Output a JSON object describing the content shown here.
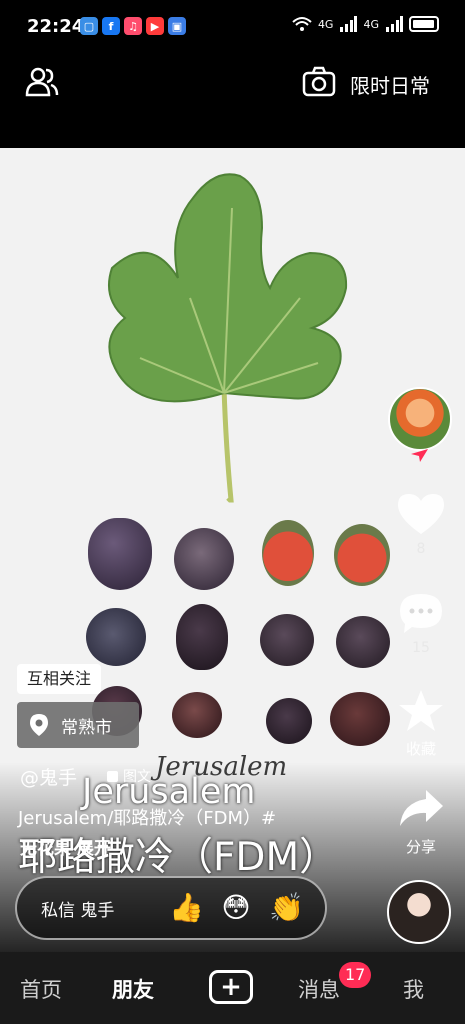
{
  "status_bar": {
    "time": "22:24",
    "notifications": [
      {
        "icon": "message-app-icon",
        "color": "#3a8ee6"
      },
      {
        "icon": "facebook-icon",
        "color": "#1877f2"
      },
      {
        "icon": "music-app-icon",
        "color": "#ff4d6d"
      },
      {
        "icon": "video-app-icon",
        "color": "#ff3b3b"
      },
      {
        "icon": "app-icon",
        "color": "#3b7de6"
      }
    ],
    "network_1": "4G",
    "network_2": "4G"
  },
  "header": {
    "daily_label": "限时日常"
  },
  "post": {
    "photo_caption_small": "Jerusalem",
    "photo_caption_big": "Jerusalem",
    "photo_caption_cn": "耶路撒冷（FDM）",
    "mutual_label": "互相关注",
    "location": "常熟市",
    "author": "@鬼手",
    "post_type": "图文",
    "title": "Jerusalem/耶路撒冷（FDM）#",
    "tag_line": "无花果 展开",
    "likes": "8",
    "comments": "15",
    "favorite_label": "收藏",
    "share_label": "分享"
  },
  "message_bar": {
    "label": "私信 鬼手",
    "emojis": [
      "👍",
      "😳",
      "👏"
    ]
  },
  "bottom_nav": {
    "items": [
      "首页",
      "朋友",
      "消息",
      "我"
    ],
    "plus": "+",
    "badge": "17"
  },
  "colors": {
    "accent": "#ff2c55",
    "photo_background": "#f2f2f2",
    "leaf": "#6aa04a"
  }
}
